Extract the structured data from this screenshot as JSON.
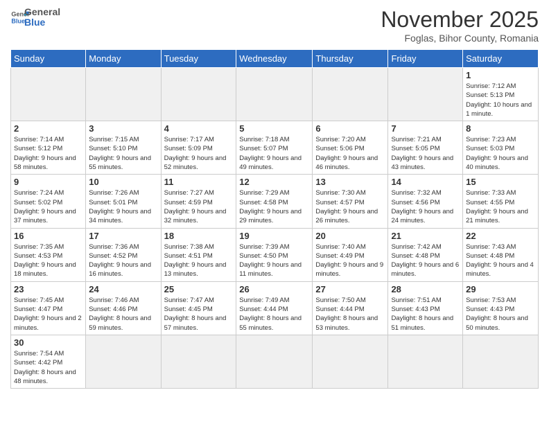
{
  "logo": {
    "general": "General",
    "blue": "Blue"
  },
  "header": {
    "month": "November 2025",
    "location": "Foglas, Bihor County, Romania"
  },
  "weekdays": [
    "Sunday",
    "Monday",
    "Tuesday",
    "Wednesday",
    "Thursday",
    "Friday",
    "Saturday"
  ],
  "weeks": [
    [
      {
        "day": "",
        "info": ""
      },
      {
        "day": "",
        "info": ""
      },
      {
        "day": "",
        "info": ""
      },
      {
        "day": "",
        "info": ""
      },
      {
        "day": "",
        "info": ""
      },
      {
        "day": "",
        "info": ""
      },
      {
        "day": "1",
        "info": "Sunrise: 7:12 AM\nSunset: 5:13 PM\nDaylight: 10 hours and 1 minute."
      }
    ],
    [
      {
        "day": "2",
        "info": "Sunrise: 7:14 AM\nSunset: 5:12 PM\nDaylight: 9 hours and 58 minutes."
      },
      {
        "day": "3",
        "info": "Sunrise: 7:15 AM\nSunset: 5:10 PM\nDaylight: 9 hours and 55 minutes."
      },
      {
        "day": "4",
        "info": "Sunrise: 7:17 AM\nSunset: 5:09 PM\nDaylight: 9 hours and 52 minutes."
      },
      {
        "day": "5",
        "info": "Sunrise: 7:18 AM\nSunset: 5:07 PM\nDaylight: 9 hours and 49 minutes."
      },
      {
        "day": "6",
        "info": "Sunrise: 7:20 AM\nSunset: 5:06 PM\nDaylight: 9 hours and 46 minutes."
      },
      {
        "day": "7",
        "info": "Sunrise: 7:21 AM\nSunset: 5:05 PM\nDaylight: 9 hours and 43 minutes."
      },
      {
        "day": "8",
        "info": "Sunrise: 7:23 AM\nSunset: 5:03 PM\nDaylight: 9 hours and 40 minutes."
      }
    ],
    [
      {
        "day": "9",
        "info": "Sunrise: 7:24 AM\nSunset: 5:02 PM\nDaylight: 9 hours and 37 minutes."
      },
      {
        "day": "10",
        "info": "Sunrise: 7:26 AM\nSunset: 5:01 PM\nDaylight: 9 hours and 34 minutes."
      },
      {
        "day": "11",
        "info": "Sunrise: 7:27 AM\nSunset: 4:59 PM\nDaylight: 9 hours and 32 minutes."
      },
      {
        "day": "12",
        "info": "Sunrise: 7:29 AM\nSunset: 4:58 PM\nDaylight: 9 hours and 29 minutes."
      },
      {
        "day": "13",
        "info": "Sunrise: 7:30 AM\nSunset: 4:57 PM\nDaylight: 9 hours and 26 minutes."
      },
      {
        "day": "14",
        "info": "Sunrise: 7:32 AM\nSunset: 4:56 PM\nDaylight: 9 hours and 24 minutes."
      },
      {
        "day": "15",
        "info": "Sunrise: 7:33 AM\nSunset: 4:55 PM\nDaylight: 9 hours and 21 minutes."
      }
    ],
    [
      {
        "day": "16",
        "info": "Sunrise: 7:35 AM\nSunset: 4:53 PM\nDaylight: 9 hours and 18 minutes."
      },
      {
        "day": "17",
        "info": "Sunrise: 7:36 AM\nSunset: 4:52 PM\nDaylight: 9 hours and 16 minutes."
      },
      {
        "day": "18",
        "info": "Sunrise: 7:38 AM\nSunset: 4:51 PM\nDaylight: 9 hours and 13 minutes."
      },
      {
        "day": "19",
        "info": "Sunrise: 7:39 AM\nSunset: 4:50 PM\nDaylight: 9 hours and 11 minutes."
      },
      {
        "day": "20",
        "info": "Sunrise: 7:40 AM\nSunset: 4:49 PM\nDaylight: 9 hours and 9 minutes."
      },
      {
        "day": "21",
        "info": "Sunrise: 7:42 AM\nSunset: 4:48 PM\nDaylight: 9 hours and 6 minutes."
      },
      {
        "day": "22",
        "info": "Sunrise: 7:43 AM\nSunset: 4:48 PM\nDaylight: 9 hours and 4 minutes."
      }
    ],
    [
      {
        "day": "23",
        "info": "Sunrise: 7:45 AM\nSunset: 4:47 PM\nDaylight: 9 hours and 2 minutes."
      },
      {
        "day": "24",
        "info": "Sunrise: 7:46 AM\nSunset: 4:46 PM\nDaylight: 8 hours and 59 minutes."
      },
      {
        "day": "25",
        "info": "Sunrise: 7:47 AM\nSunset: 4:45 PM\nDaylight: 8 hours and 57 minutes."
      },
      {
        "day": "26",
        "info": "Sunrise: 7:49 AM\nSunset: 4:44 PM\nDaylight: 8 hours and 55 minutes."
      },
      {
        "day": "27",
        "info": "Sunrise: 7:50 AM\nSunset: 4:44 PM\nDaylight: 8 hours and 53 minutes."
      },
      {
        "day": "28",
        "info": "Sunrise: 7:51 AM\nSunset: 4:43 PM\nDaylight: 8 hours and 51 minutes."
      },
      {
        "day": "29",
        "info": "Sunrise: 7:53 AM\nSunset: 4:43 PM\nDaylight: 8 hours and 50 minutes."
      }
    ],
    [
      {
        "day": "30",
        "info": "Sunrise: 7:54 AM\nSunset: 4:42 PM\nDaylight: 8 hours and 48 minutes."
      },
      {
        "day": "",
        "info": ""
      },
      {
        "day": "",
        "info": ""
      },
      {
        "day": "",
        "info": ""
      },
      {
        "day": "",
        "info": ""
      },
      {
        "day": "",
        "info": ""
      },
      {
        "day": "",
        "info": ""
      }
    ]
  ]
}
